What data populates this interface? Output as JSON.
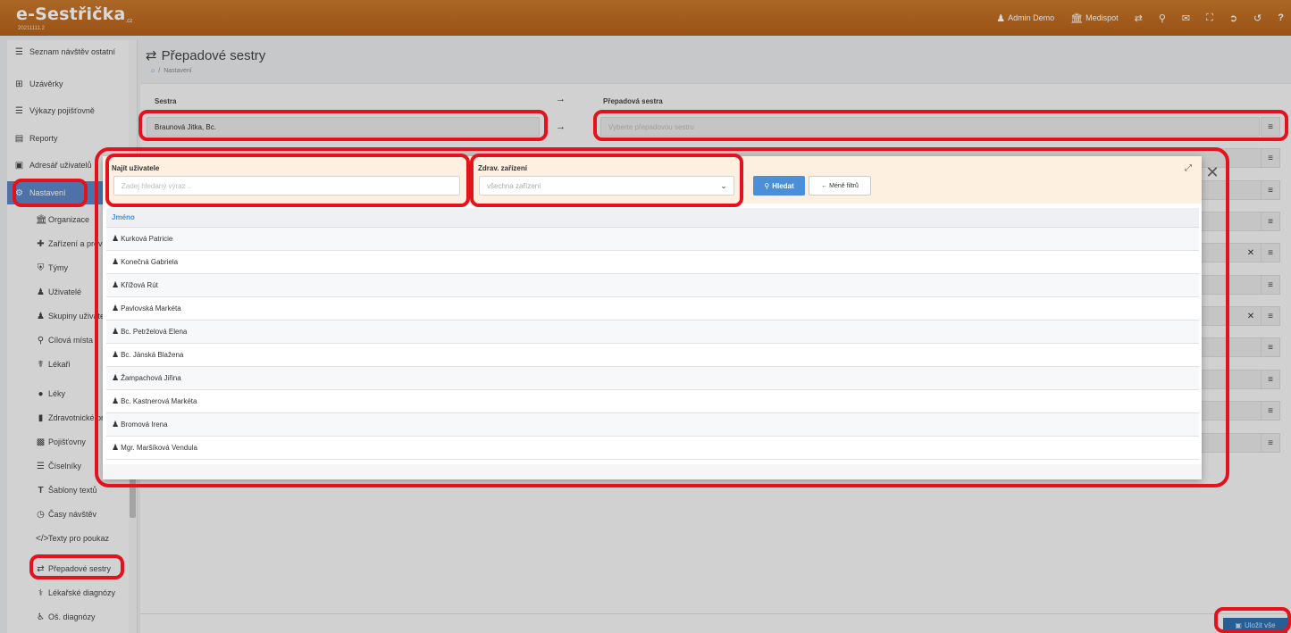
{
  "app": {
    "logo": "e-Sestřička",
    "logo_suffix": ".cz",
    "version": "20211111.2"
  },
  "topnav": {
    "user": "Admin Demo",
    "org": "Medispot"
  },
  "sidebar": {
    "items": [
      {
        "label": "Seznam návštěv ostatní",
        "icon": "list-icon"
      },
      {
        "label": "Uzávěrky",
        "icon": "table-icon"
      },
      {
        "label": "Výkazy pojišťovně",
        "icon": "list-icon"
      },
      {
        "label": "Reporty",
        "icon": "chart-icon"
      },
      {
        "label": "Adresář uživatelů",
        "icon": "address-book-icon"
      },
      {
        "label": "Nastavení",
        "icon": "gear-icon"
      }
    ],
    "sub_items": [
      {
        "label": "Organizace",
        "icon": "bank-icon"
      },
      {
        "label": "Zařízení a provozy",
        "icon": "clinic-icon"
      },
      {
        "label": "Týmy",
        "icon": "shield-icon"
      },
      {
        "label": "Uživatelé",
        "icon": "user-icon"
      },
      {
        "label": "Skupiny uživatelů",
        "icon": "users-icon"
      },
      {
        "label": "Cílová místa",
        "icon": "map-marker-icon"
      },
      {
        "label": "Lékaři",
        "icon": "doctor-icon"
      },
      {
        "label": "Léky",
        "icon": "pills-icon"
      },
      {
        "label": "Zdravotnické prostředky",
        "icon": "barcode-icon"
      },
      {
        "label": "Pojišťovny",
        "icon": "building-icon"
      },
      {
        "label": "Číselníky",
        "icon": "list-icon"
      },
      {
        "label": "Šablony textů",
        "icon": "text-icon"
      },
      {
        "label": "Časy návštěv",
        "icon": "clock-icon"
      },
      {
        "label": "Texty pro poukaz",
        "icon": "code-icon"
      },
      {
        "label": "Přepadové sestry",
        "icon": "exchange-icon"
      },
      {
        "label": "Lékařské diagnózy",
        "icon": "stethoscope-icon"
      },
      {
        "label": "Oš. diagnózy",
        "icon": "wheelchair-icon"
      }
    ]
  },
  "page": {
    "title": "Přepadové sestry",
    "breadcrumb": "Nastavení",
    "col_nurse": "Sestra",
    "col_backup": "Přepadová sestra",
    "nurse_value": "Braunová Jitka, Bc.",
    "backup_placeholder": "Vyberte přepadovou sestru",
    "save_label": "Uložit vše"
  },
  "modal": {
    "find_user_label": "Najít uživatele",
    "find_user_placeholder": "Zadej hledaný výraz ..",
    "facility_label": "Zdrav. zařízení",
    "facility_value": "všechna zařízení",
    "search_label": "Hledat",
    "less_filters_label": "Méně filtrů",
    "column_name": "Jméno",
    "rows": [
      "Kurková Patricie",
      "Konečná Gabriela",
      "Křížová Rút",
      "Pavlovská Markéta",
      "Bc. Petrželová Elena",
      "Bc. Jánská Blažena",
      "Žampachová Jiřina",
      "Bc. Kastnerová Markéta",
      "Bromová Irena",
      "Mgr. Maršíková Vendula"
    ]
  },
  "colors": {
    "topbar": "#c06d22",
    "accent": "#4a8fd8",
    "highlight": "#e3121c",
    "filter_bg": "#fdf0e0"
  }
}
